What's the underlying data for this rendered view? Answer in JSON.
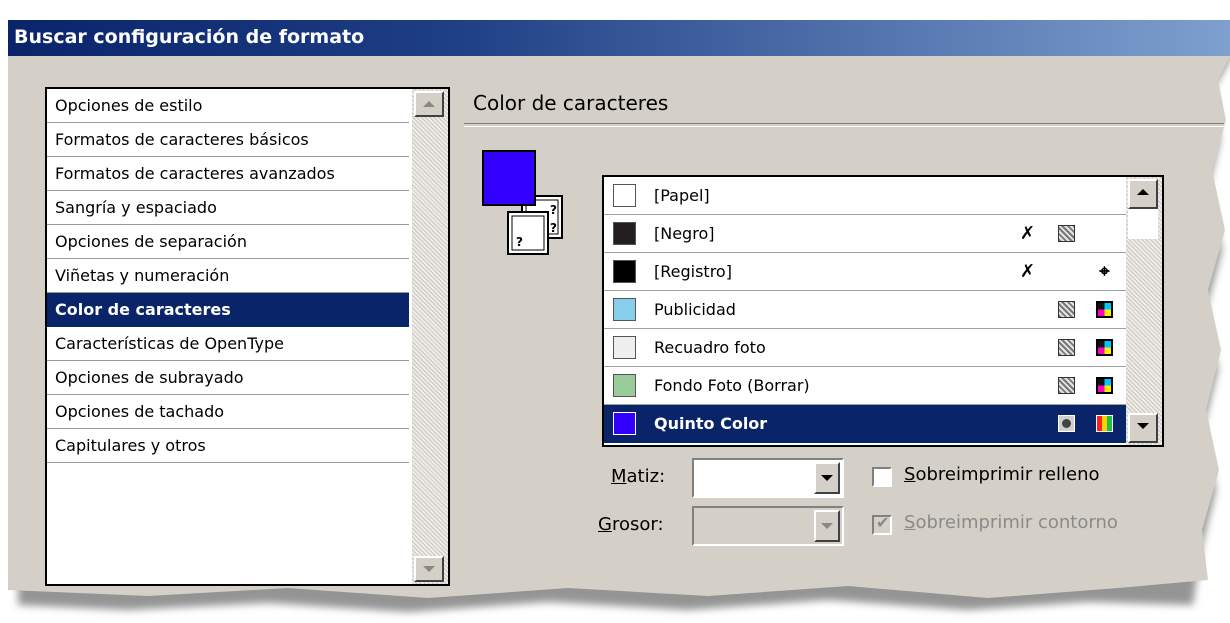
{
  "window": {
    "title": "Buscar configuración de formato"
  },
  "categories": [
    {
      "label": "Opciones de estilo",
      "selected": false
    },
    {
      "label": "Formatos de caracteres básicos",
      "selected": false
    },
    {
      "label": "Formatos de caracteres avanzados",
      "selected": false
    },
    {
      "label": "Sangría y espaciado",
      "selected": false
    },
    {
      "label": "Opciones de separación",
      "selected": false
    },
    {
      "label": "Viñetas y numeración",
      "selected": false
    },
    {
      "label": "Color de caracteres",
      "selected": true
    },
    {
      "label": "Características de OpenType",
      "selected": false
    },
    {
      "label": "Opciones de subrayado",
      "selected": false
    },
    {
      "label": "Opciones de tachado",
      "selected": false
    },
    {
      "label": "Capitulares y otros",
      "selected": false
    }
  ],
  "panel": {
    "heading": "Color de caracteres",
    "fill_color": "#3300ff",
    "swatches": [
      {
        "name": "[Papel]",
        "color": "#ffffff",
        "icons": []
      },
      {
        "name": "[Negro]",
        "color": "#231f20",
        "icons": [
          "no-edit-icon",
          "process-gray-icon"
        ]
      },
      {
        "name": "[Registro]",
        "color": "#000000",
        "icons": [
          "no-edit-icon",
          "registration-icon"
        ]
      },
      {
        "name": "Publicidad",
        "color": "#87ceeb",
        "icons": [
          "process-gray-icon",
          "cmyk-icon"
        ]
      },
      {
        "name": "Recuadro foto",
        "color": "#eeeeee",
        "icons": [
          "process-gray-icon",
          "cmyk-icon"
        ]
      },
      {
        "name": "Fondo Foto (Borrar)",
        "color": "#99cc99",
        "icons": [
          "process-gray-icon",
          "cmyk-icon"
        ]
      },
      {
        "name": "Quinto Color",
        "color": "#3300ff",
        "icons": [
          "spot-icon",
          "multicolor-icon"
        ],
        "selected": true
      }
    ],
    "tint": {
      "label_pre": "",
      "label_key": "M",
      "label_rest": "atiz:",
      "value": ""
    },
    "stroke": {
      "label_key": "G",
      "label_rest": "rosor:",
      "value": ""
    },
    "overprint_fill": {
      "label_key": "S",
      "label_rest": "obreimprimir relleno",
      "checked": false
    },
    "overprint_stroke": {
      "label_key": "S",
      "label_rest": "obreimprimir contorno",
      "checked": true,
      "disabled": true
    }
  }
}
